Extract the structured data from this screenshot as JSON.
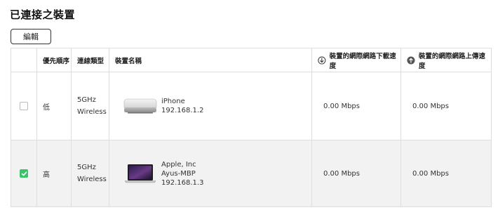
{
  "page": {
    "title": "已連接之裝置"
  },
  "toolbar": {
    "edit_label": "編輯"
  },
  "table": {
    "headers": {
      "priority": "優先順序",
      "connection": "連線類型",
      "name": "裝置名稱",
      "download": "裝置的網際網路下載速度",
      "upload": "裝置的網際網路上傳速度"
    },
    "rows": [
      {
        "checked": false,
        "priority": "低",
        "connection_line1": "5GHz",
        "connection_line2": "Wireless",
        "device_icon": "mac-mini-icon",
        "name_line1": "iPhone",
        "name_line2": "192.168.1.2",
        "name_line3": "",
        "download": "0.00 Mbps",
        "upload": "0.00 Mbps"
      },
      {
        "checked": true,
        "priority": "高",
        "connection_line1": "5GHz",
        "connection_line2": "Wireless",
        "device_icon": "macbook-pro-icon",
        "name_line1": "Apple, Inc",
        "name_line2": "Ayus-MBP",
        "name_line3": "192.168.1.3",
        "download": "0.00 Mbps",
        "upload": "0.00 Mbps"
      }
    ]
  },
  "colors": {
    "checked": "#3fc16b",
    "border": "#dedede",
    "row_alt": "#f2f2f2"
  }
}
